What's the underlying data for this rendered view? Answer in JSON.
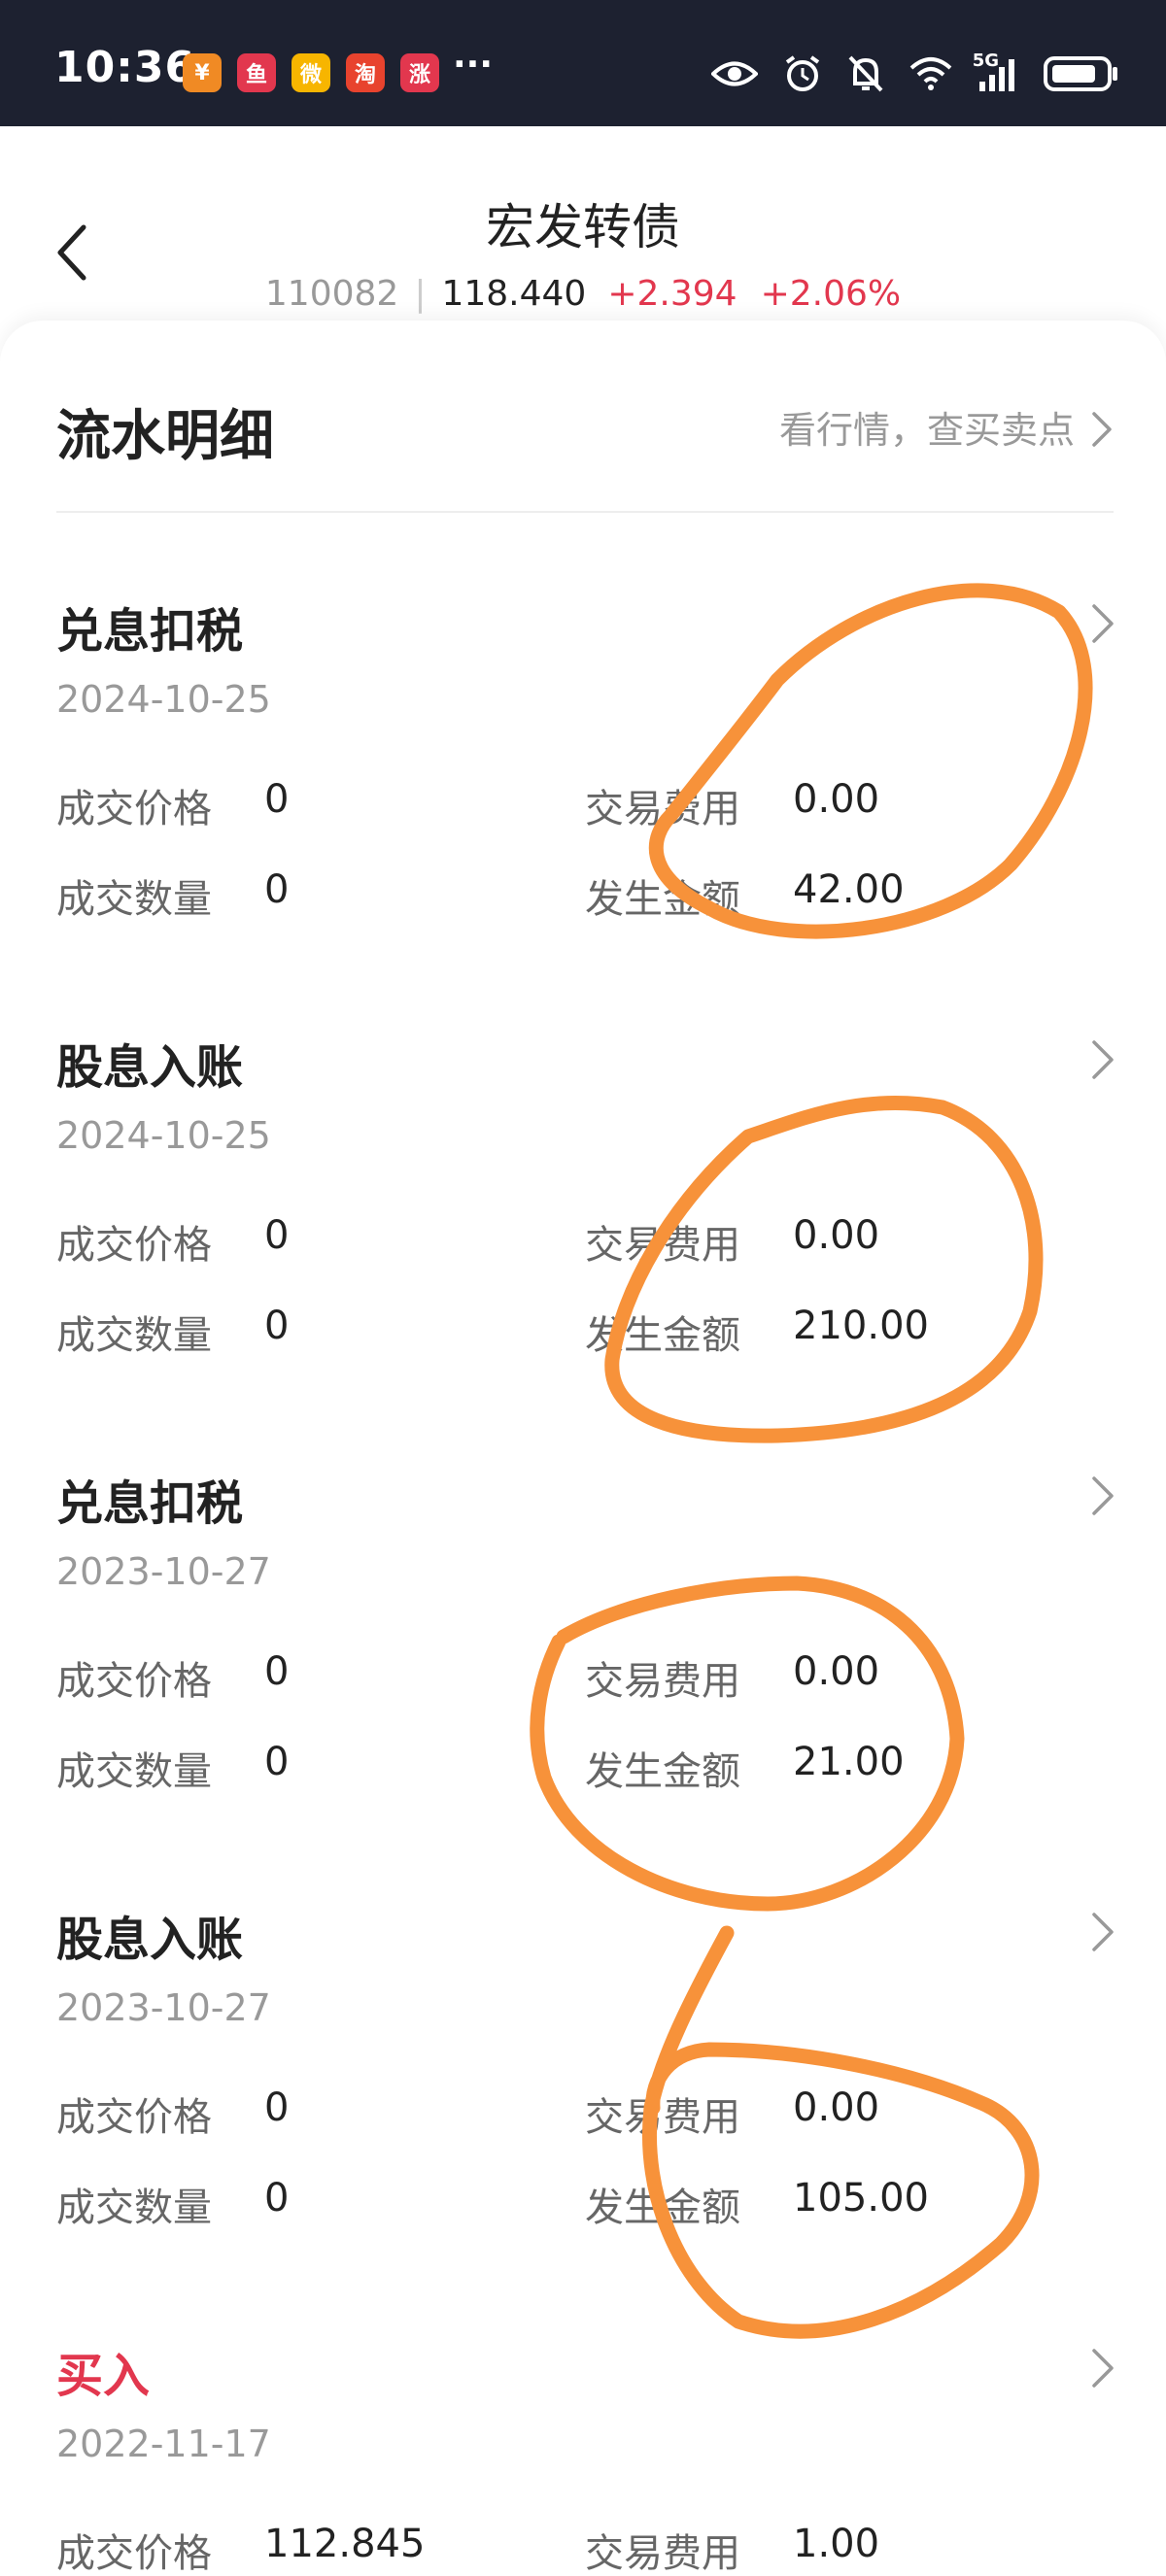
{
  "status_bar": {
    "time": "10:36",
    "network": "5G",
    "apps": [
      {
        "icon": "wallet-app-icon",
        "glyph": "¥",
        "color": "#f08a24"
      },
      {
        "icon": "news-app-icon",
        "glyph": "鱼",
        "color": "#e2374e"
      },
      {
        "icon": "weibo-app-icon",
        "glyph": "微",
        "color": "#f7b500"
      },
      {
        "icon": "taobao-app-icon",
        "glyph": "淘",
        "color": "#e8432e"
      },
      {
        "icon": "zhang-app-icon",
        "glyph": "涨",
        "color": "#e2374e"
      }
    ],
    "more": "···"
  },
  "header": {
    "title": "宏发转债",
    "code": "110082",
    "price": "118.440",
    "change": "+2.394",
    "change_pct": "+2.06%"
  },
  "section": {
    "title": "流水明细",
    "link": "看行情，查买卖点"
  },
  "labels": {
    "price": "成交价格",
    "qty": "成交数量",
    "fee": "交易费用",
    "amount": "发生金额"
  },
  "records": [
    {
      "type": "兑息扣税",
      "date": "2024-10-25",
      "price": "0",
      "qty": "0",
      "fee": "0.00",
      "amount": "42.00"
    },
    {
      "type": "股息入账",
      "date": "2024-10-25",
      "price": "0",
      "qty": "0",
      "fee": "0.00",
      "amount": "210.00"
    },
    {
      "type": "兑息扣税",
      "date": "2023-10-27",
      "price": "0",
      "qty": "0",
      "fee": "0.00",
      "amount": "21.00"
    },
    {
      "type": "股息入账",
      "date": "2023-10-27",
      "price": "0",
      "qty": "0",
      "fee": "0.00",
      "amount": "105.00"
    },
    {
      "type": "买入",
      "date": "2022-11-17",
      "price": "112.845",
      "fee": "1.00"
    }
  ],
  "colors": {
    "accent_red": "#e2374e",
    "annotation_orange": "#f7923a",
    "status_bar_bg": "#1d2130"
  }
}
